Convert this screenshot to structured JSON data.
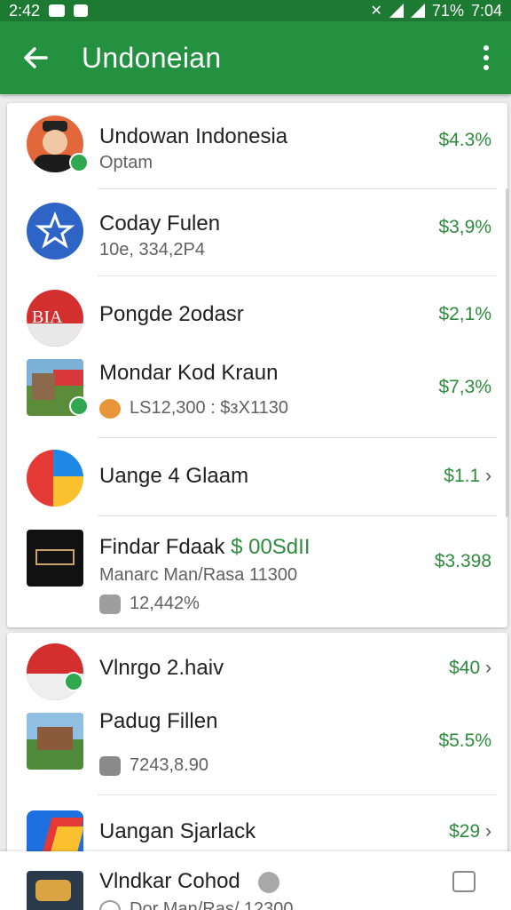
{
  "status": {
    "time_left": "2:42",
    "battery": "71%",
    "time_right": "7:04"
  },
  "appbar": {
    "title": "Undoneian"
  },
  "items": [
    {
      "name": "Undowan Indonesia",
      "sub": "Optam",
      "value": "$4.3%"
    },
    {
      "name": "Coday Fulen",
      "sub": "10e, 334,2P4",
      "value": "$3,9%"
    },
    {
      "name": "Pongde 2odasr",
      "sub": "",
      "value": "$2,1%"
    },
    {
      "name": "Mondar Kod Kraun",
      "sub": "LS12,300 : $зХ1130",
      "value": "$7,3%"
    },
    {
      "name": "Uange 4 Glaam",
      "sub": "",
      "value": "$1.1",
      "chevron": "›"
    },
    {
      "name": "Findar Fdaak",
      "name_extra": "$ 00SdII",
      "sub": "Manarc Man/Rasa 11300",
      "sub2": "12,442%",
      "value": "$3.398"
    },
    {
      "name": "Vlnrgo 2.haiv",
      "sub": "",
      "value": "$40",
      "chevron": "›"
    },
    {
      "name": "Padug Fillen",
      "sub": "7243,8.90",
      "value": "$5.5%"
    },
    {
      "name": "Uangan Sjarlack",
      "sub": "",
      "value": "$29",
      "chevron": "›"
    },
    {
      "name": "Vlndkar Cohod",
      "sub": "Dor Man/Ras/ 12300",
      "value": ""
    }
  ],
  "colors": {
    "appbar": "#23913f",
    "statusbar": "#1d7a33",
    "value_green": "#2e8b3e"
  }
}
